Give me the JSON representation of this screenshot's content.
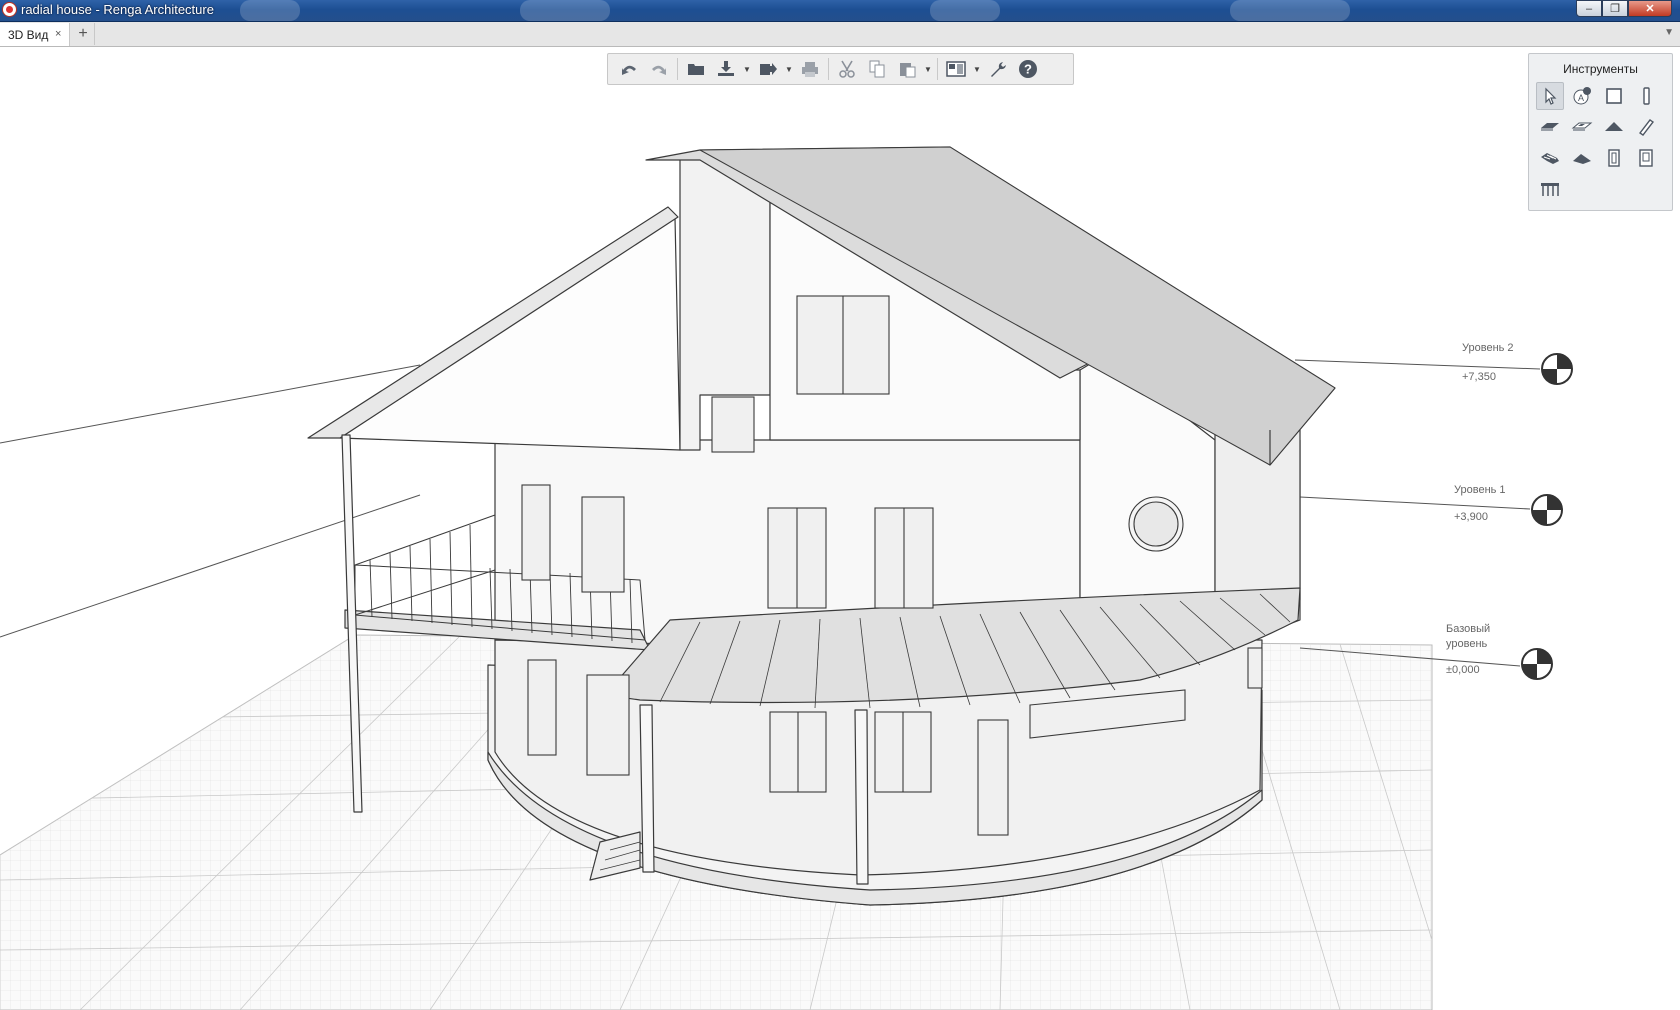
{
  "window": {
    "title": "radial house - Renga Architecture",
    "controls": {
      "minimize": "–",
      "restore": "❐",
      "close": "✕"
    }
  },
  "tabs": {
    "items": [
      {
        "label": "3D Вид",
        "close": "×"
      }
    ],
    "add": "+",
    "menu": "▼"
  },
  "toolbar": {
    "buttons": [
      "undo-icon",
      "redo-icon",
      "open-icon",
      "import-icon",
      "export-icon",
      "print-icon",
      "cut-icon",
      "copy-icon",
      "paste-icon",
      "views-icon",
      "settings-icon",
      "help-icon"
    ]
  },
  "tools_panel": {
    "title": "Инструменты",
    "tools": [
      "select-icon",
      "annotation-icon",
      "wall-icon",
      "column-icon",
      "floor-icon",
      "opening-icon",
      "roof-icon",
      "beam-icon",
      "stair-icon",
      "ramp-icon",
      "window-icon",
      "door-icon",
      "railing-icon"
    ],
    "active": "select-icon"
  },
  "levels": [
    {
      "name": "Уровень 2",
      "elevation": "+7,350"
    },
    {
      "name": "Уровень 1",
      "elevation": "+3,900"
    },
    {
      "name_line1": "Базовый",
      "name_line2": "уровень",
      "elevation": "±0,000"
    }
  ],
  "colors": {
    "titlebar": "#1d4f93",
    "accent_close": "#c23a23",
    "panel_bg": "#eef0f2",
    "model_line": "#3a3a3a",
    "grid": "#d8d8d8"
  }
}
